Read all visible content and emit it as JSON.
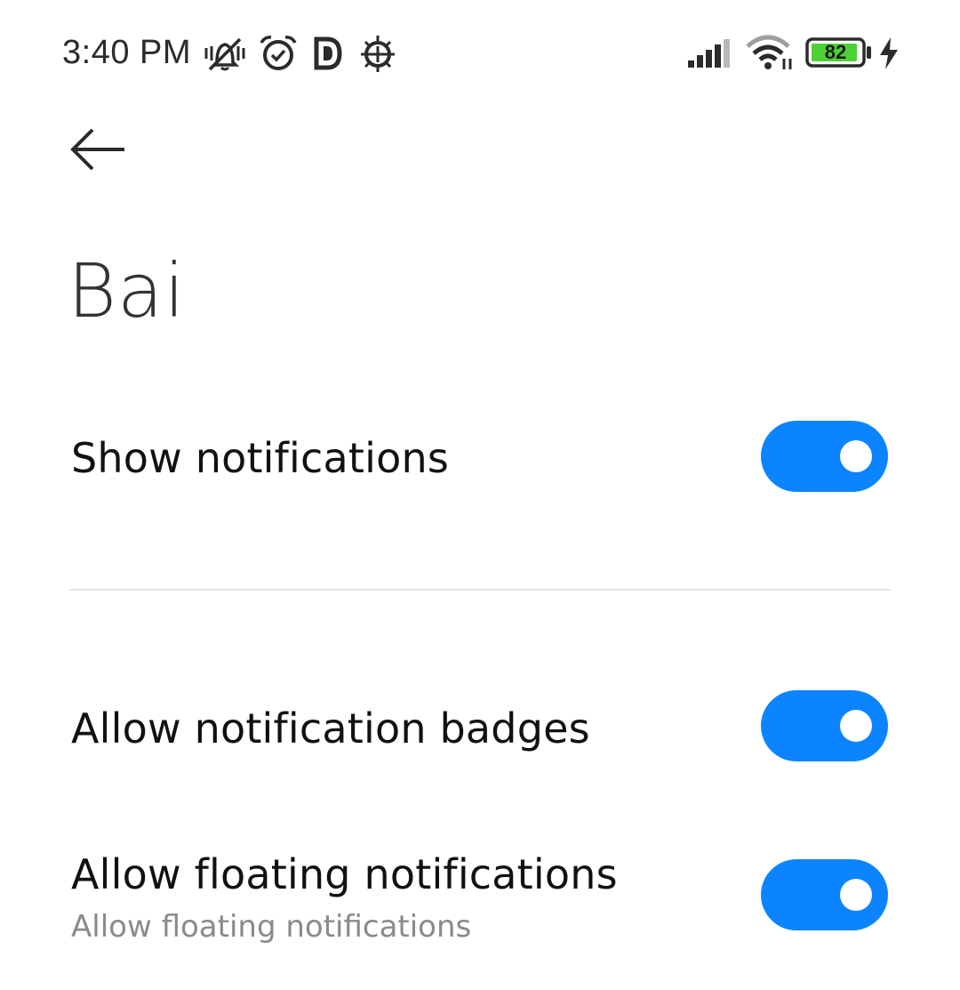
{
  "status_bar": {
    "time": "3:40 PM",
    "battery_level": "82",
    "icons": [
      "vibrate-off-icon",
      "alarm-icon",
      "d-app-icon",
      "android-bug-icon",
      "signal-icon",
      "wifi-icon",
      "battery-icon",
      "charging-bolt-icon"
    ],
    "battery_color": "#4cd137"
  },
  "header": {
    "back_icon": "back-arrow-icon",
    "title": "Bai"
  },
  "settings": [
    {
      "label": "Show notifications",
      "enabled": true
    },
    {
      "label": "Allow notification badges",
      "enabled": true
    },
    {
      "label": "Allow floating notifications",
      "subtitle": "Allow floating notifications",
      "enabled": true
    }
  ],
  "colors": {
    "toggle_on": "#0d84ff",
    "divider": "#e6e6e6",
    "subtitle": "#8a8a8a"
  }
}
